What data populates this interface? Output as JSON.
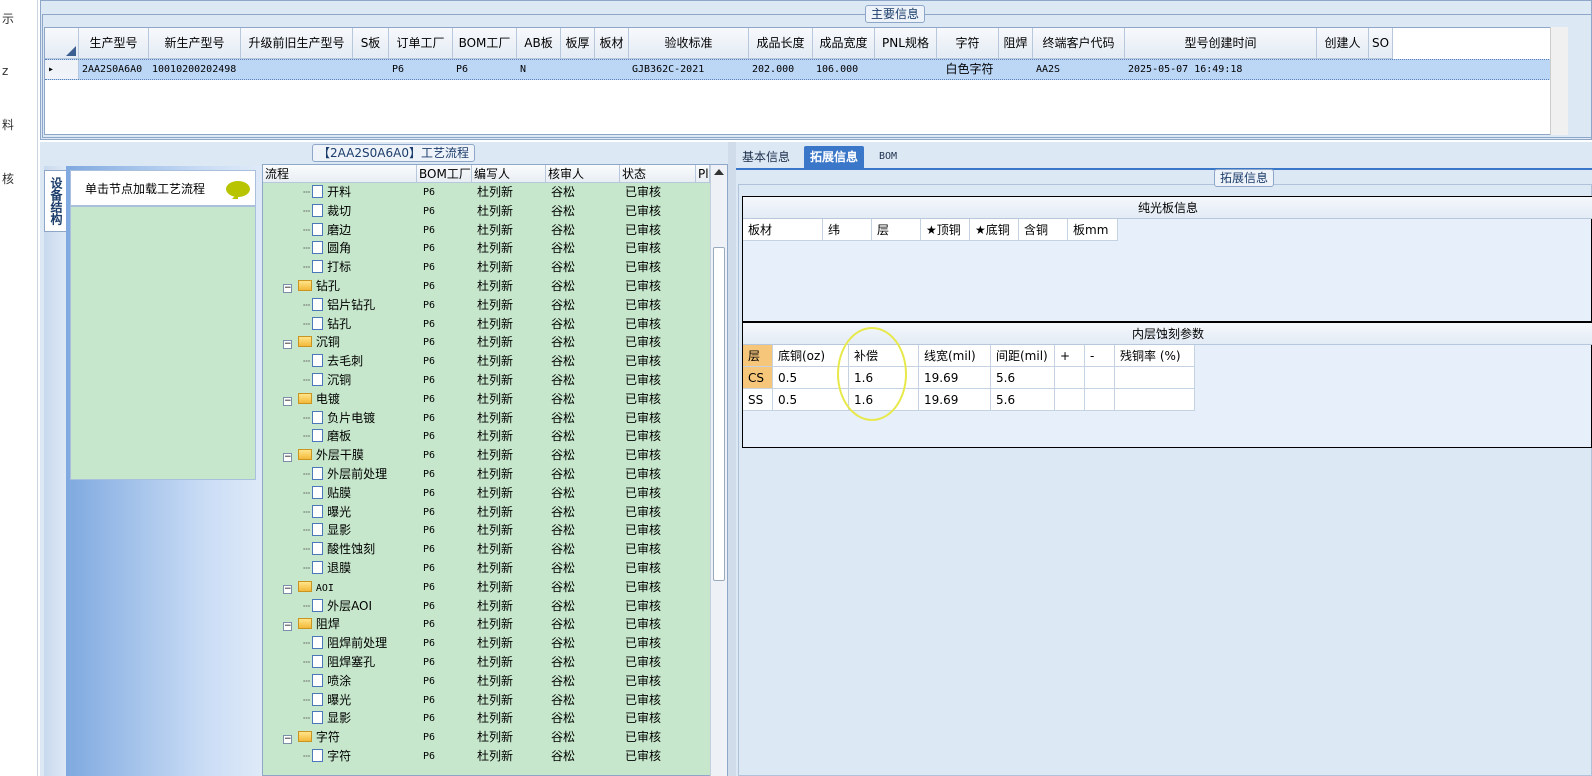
{
  "left_strip": [
    "示",
    "z",
    "料",
    "核"
  ],
  "main_info": {
    "legend": "主要信息",
    "columns": [
      "生产型号",
      "新生产型号",
      "升级前旧生产型号",
      "S板",
      "订单工厂",
      "BOM工厂",
      "AB板",
      "板厚",
      "板材",
      "验收标准",
      "成品长度",
      "成品宽度",
      "PNL规格",
      "字符",
      "阻焊",
      "终端客户代码",
      "型号创建时间",
      "创建人",
      "SO"
    ],
    "row": {
      "生产型号": "2AA2S0A6A0",
      "新生产型号": "10010200202498",
      "订单工厂": "P6",
      "BOM工厂": "P6",
      "AB板": "N",
      "验收标准": "GJB362C-2021",
      "成品长度": "202.000",
      "成品宽度": "106.000",
      "字符": "白色字符",
      "终端客户代码": "AA2S",
      "型号创建时间": "2025-05-07 16:49:18"
    }
  },
  "left_panel": {
    "vertical_tab": "设备结构",
    "nav_item": "单击节点加载工艺流程"
  },
  "process": {
    "legend": "【2AA2S0A6A0】工艺流程",
    "columns": [
      "流程",
      "BOM工厂",
      "编写人",
      "核审人",
      "状态",
      "Pl"
    ],
    "rows": [
      {
        "name": "开料",
        "type": "doc",
        "bom": "P6",
        "writer": "杜列新",
        "reviewer": "谷松",
        "status": "已审核"
      },
      {
        "name": "裁切",
        "type": "doc",
        "bom": "P6",
        "writer": "杜列新",
        "reviewer": "谷松",
        "status": "已审核"
      },
      {
        "name": "磨边",
        "type": "doc",
        "bom": "P6",
        "writer": "杜列新",
        "reviewer": "谷松",
        "status": "已审核"
      },
      {
        "name": "圆角",
        "type": "doc",
        "bom": "P6",
        "writer": "杜列新",
        "reviewer": "谷松",
        "status": "已审核"
      },
      {
        "name": "打标",
        "type": "doc",
        "bom": "P6",
        "writer": "杜列新",
        "reviewer": "谷松",
        "status": "已审核"
      },
      {
        "name": "钻孔",
        "type": "folder",
        "bom": "P6",
        "writer": "杜列新",
        "reviewer": "谷松",
        "status": "已审核"
      },
      {
        "name": "铝片钻孔",
        "type": "doc",
        "bom": "P6",
        "writer": "杜列新",
        "reviewer": "谷松",
        "status": "已审核"
      },
      {
        "name": "钻孔",
        "type": "doc",
        "bom": "P6",
        "writer": "杜列新",
        "reviewer": "谷松",
        "status": "已审核"
      },
      {
        "name": "沉铜",
        "type": "folder",
        "bom": "P6",
        "writer": "杜列新",
        "reviewer": "谷松",
        "status": "已审核"
      },
      {
        "name": "去毛刺",
        "type": "doc",
        "bom": "P6",
        "writer": "杜列新",
        "reviewer": "谷松",
        "status": "已审核"
      },
      {
        "name": "沉铜",
        "type": "doc",
        "bom": "P6",
        "writer": "杜列新",
        "reviewer": "谷松",
        "status": "已审核"
      },
      {
        "name": "电镀",
        "type": "folder",
        "bom": "P6",
        "writer": "杜列新",
        "reviewer": "谷松",
        "status": "已审核"
      },
      {
        "name": "负片电镀",
        "type": "doc",
        "bom": "P6",
        "writer": "杜列新",
        "reviewer": "谷松",
        "status": "已审核"
      },
      {
        "name": "磨板",
        "type": "doc",
        "bom": "P6",
        "writer": "杜列新",
        "reviewer": "谷松",
        "status": "已审核"
      },
      {
        "name": "外层干膜",
        "type": "folder",
        "bom": "P6",
        "writer": "杜列新",
        "reviewer": "谷松",
        "status": "已审核"
      },
      {
        "name": "外层前处理",
        "type": "doc",
        "bom": "P6",
        "writer": "杜列新",
        "reviewer": "谷松",
        "status": "已审核"
      },
      {
        "name": "贴膜",
        "type": "doc",
        "bom": "P6",
        "writer": "杜列新",
        "reviewer": "谷松",
        "status": "已审核"
      },
      {
        "name": "曝光",
        "type": "doc",
        "bom": "P6",
        "writer": "杜列新",
        "reviewer": "谷松",
        "status": "已审核"
      },
      {
        "name": "显影",
        "type": "doc",
        "bom": "P6",
        "writer": "杜列新",
        "reviewer": "谷松",
        "status": "已审核"
      },
      {
        "name": "酸性蚀刻",
        "type": "doc",
        "bom": "P6",
        "writer": "杜列新",
        "reviewer": "谷松",
        "status": "已审核"
      },
      {
        "name": "退膜",
        "type": "doc",
        "bom": "P6",
        "writer": "杜列新",
        "reviewer": "谷松",
        "status": "已审核"
      },
      {
        "name": "AOI",
        "type": "folder",
        "bom": "P6",
        "writer": "杜列新",
        "reviewer": "谷松",
        "status": "已审核"
      },
      {
        "name": "外层AOI",
        "type": "doc",
        "bom": "P6",
        "writer": "杜列新",
        "reviewer": "谷松",
        "status": "已审核"
      },
      {
        "name": "阻焊",
        "type": "folder",
        "bom": "P6",
        "writer": "杜列新",
        "reviewer": "谷松",
        "status": "已审核"
      },
      {
        "name": "阻焊前处理",
        "type": "doc",
        "bom": "P6",
        "writer": "杜列新",
        "reviewer": "谷松",
        "status": "已审核"
      },
      {
        "name": "阻焊塞孔",
        "type": "doc",
        "bom": "P6",
        "writer": "杜列新",
        "reviewer": "谷松",
        "status": "已审核"
      },
      {
        "name": "喷涂",
        "type": "doc",
        "bom": "P6",
        "writer": "杜列新",
        "reviewer": "谷松",
        "status": "已审核"
      },
      {
        "name": "曝光",
        "type": "doc",
        "bom": "P6",
        "writer": "杜列新",
        "reviewer": "谷松",
        "status": "已审核"
      },
      {
        "name": "显影",
        "type": "doc",
        "bom": "P6",
        "writer": "杜列新",
        "reviewer": "谷松",
        "status": "已审核"
      },
      {
        "name": "字符",
        "type": "folder",
        "bom": "P6",
        "writer": "杜列新",
        "reviewer": "谷松",
        "status": "已审核"
      },
      {
        "name": "字符",
        "type": "doc",
        "bom": "P6",
        "writer": "杜列新",
        "reviewer": "谷松",
        "status": "已审核"
      }
    ]
  },
  "right_tabs": [
    "基本信息",
    "拓展信息",
    "BOM"
  ],
  "active_tab": "拓展信息",
  "ext": {
    "legend": "拓展信息",
    "plain_board": {
      "title": "纯光板信息",
      "columns": [
        "板材",
        "纬",
        "层",
        "★顶铜",
        "★底铜",
        "含铜",
        "板mm"
      ]
    },
    "inner_etch": {
      "title": "内层蚀刻参数",
      "columns": [
        "层",
        "底铜(oz)",
        "补偿",
        "线宽(mil)",
        "间距(mil)",
        "+",
        "-",
        "残铜率 (%)"
      ],
      "rows": [
        [
          "CS",
          "0.5",
          "1.6",
          "19.69",
          "5.6",
          "",
          "",
          ""
        ],
        [
          "SS",
          "0.5",
          "1.6",
          "19.69",
          "5.6",
          "",
          "",
          ""
        ]
      ]
    }
  }
}
